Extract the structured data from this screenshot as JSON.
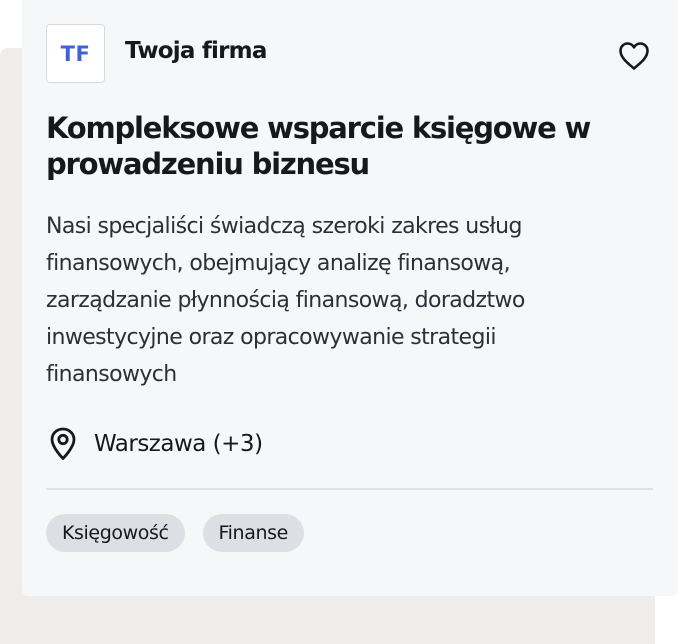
{
  "company": {
    "logo_initials": "TF",
    "name": "Twoja firma"
  },
  "offer": {
    "title": "Kompleksowe wsparcie księgowe w prowadzeniu biznesu",
    "description": "Nasi specjaliści świadczą szeroki zakres usług finansowych, obejmujący analizę finansową, zarządzanie płynnością finansową, doradztwo inwestycyjne oraz opracowywanie strategii finansowych",
    "location": "Warszawa (+3)"
  },
  "tags": [
    "Księgowość",
    "Finanse"
  ],
  "icons": {
    "favorite": "heart-outline-icon",
    "location": "map-pin-icon"
  },
  "colors": {
    "logo_text": "#3f63d6",
    "card_background": "#f6f7f9",
    "tag_background": "#dcdfe3",
    "backdrop": "#efedeb"
  }
}
